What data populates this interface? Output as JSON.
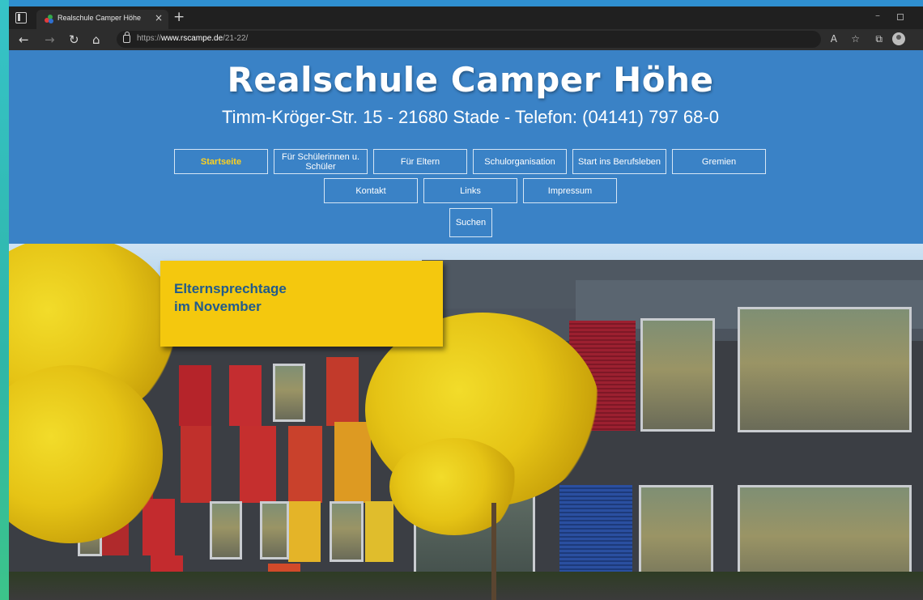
{
  "browser": {
    "tab_title": "Realschule Camper Höhe",
    "tab_close": "×",
    "new_tab": "+",
    "url_prefix": "https://",
    "url_domain": "www.rscampe.de",
    "url_path": "/21-22/"
  },
  "site": {
    "title": "Realschule Camper Höhe",
    "address": "Timm-Kröger-Str. 15 - 21680 Stade - Telefon: (04141) 797 68-0",
    "nav_row1": [
      {
        "label": "Startseite",
        "active": true
      },
      {
        "label": "Für Schülerinnen u. Schüler"
      },
      {
        "label": "Für Eltern"
      },
      {
        "label": "Schulorganisation"
      },
      {
        "label": "Start ins Berufsleben"
      },
      {
        "label": "Gremien"
      }
    ],
    "nav_row2": [
      {
        "label": "Kontakt"
      },
      {
        "label": "Links"
      },
      {
        "label": "Impressum"
      }
    ],
    "search_label": "Suchen"
  },
  "hero": {
    "banner_line1": "Elternsprechtage",
    "banner_line2": "im November"
  },
  "colors": {
    "header_blue": "#3a82c6",
    "active_nav": "#ffd21e",
    "banner_yellow": "#f4c80e",
    "banner_text": "#215b8c"
  }
}
